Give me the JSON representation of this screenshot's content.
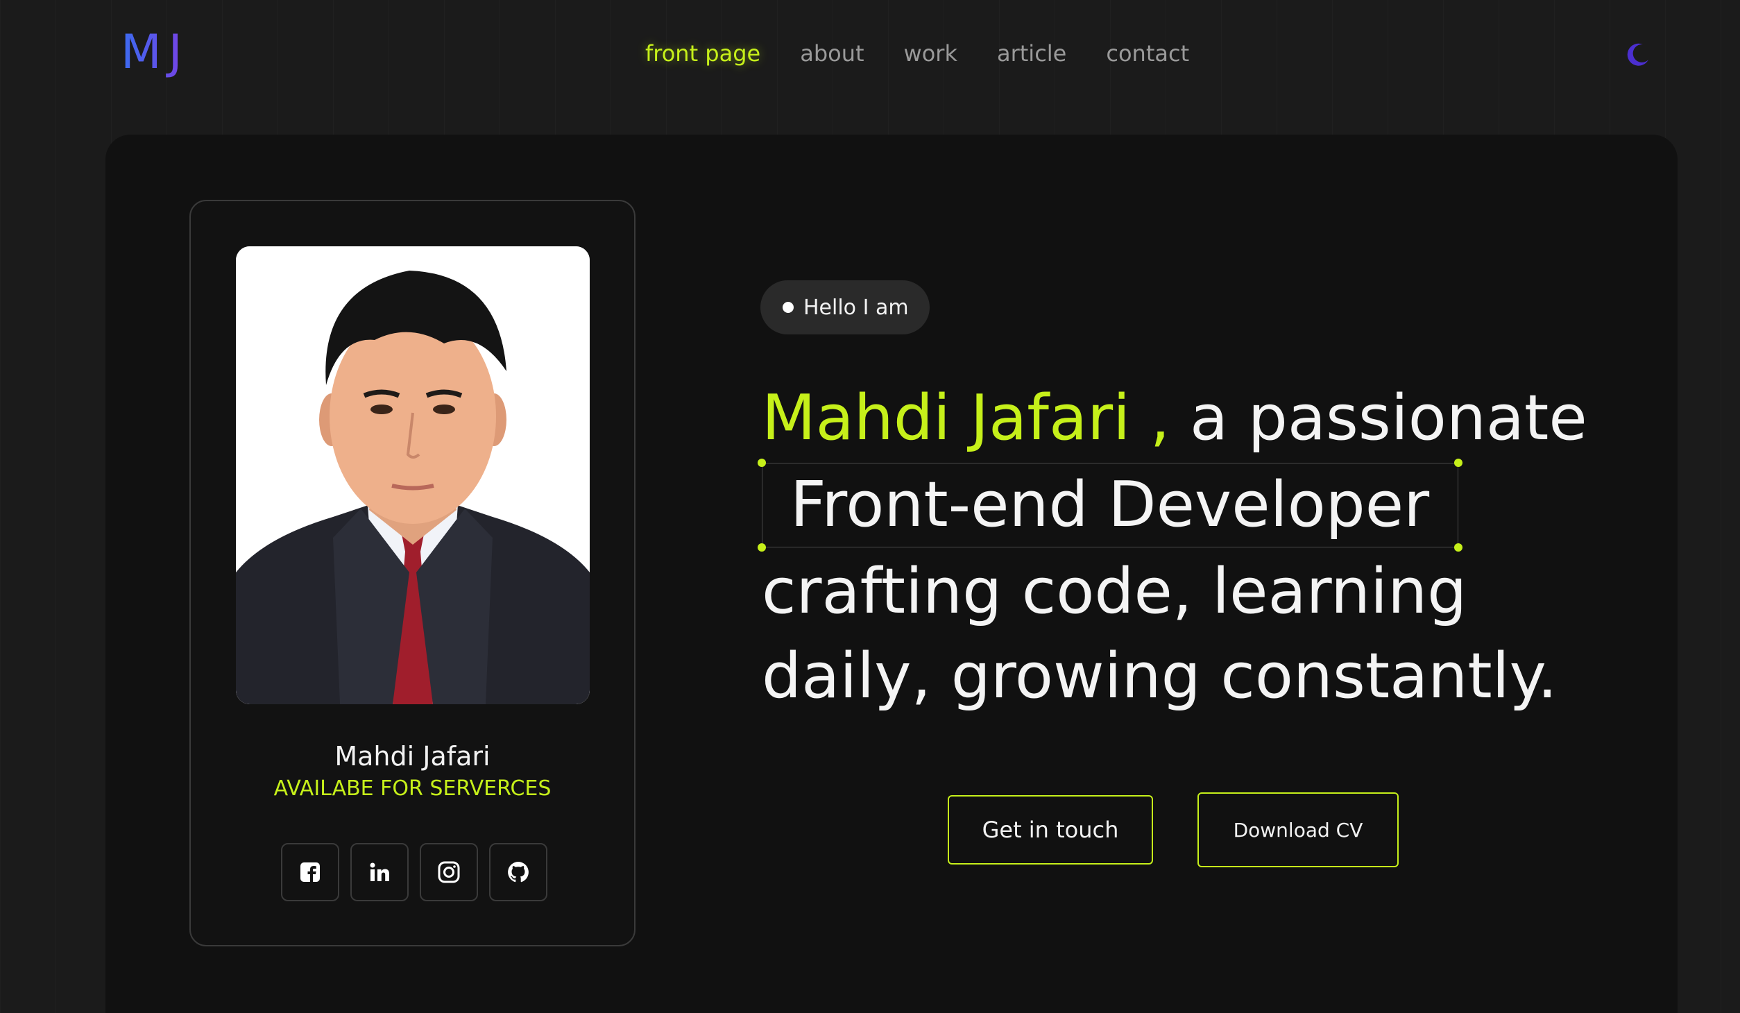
{
  "header": {
    "logo": "MJ",
    "nav": [
      {
        "label": "front page",
        "active": true
      },
      {
        "label": "about",
        "active": false
      },
      {
        "label": "work",
        "active": false
      },
      {
        "label": "article",
        "active": false
      },
      {
        "label": "contact",
        "active": false
      }
    ],
    "theme_icon": "moon-icon"
  },
  "profile": {
    "name": "Mahdi Jafari",
    "status": "AVAILABE FOR SERVERCES",
    "photo_icon": "profile-photo",
    "socials": [
      {
        "icon": "facebook-icon"
      },
      {
        "icon": "linkedin-icon"
      },
      {
        "icon": "instagram-icon"
      },
      {
        "icon": "github-icon"
      }
    ]
  },
  "hero": {
    "badge": "Hello I am",
    "name": "Mahdi Jafari ,",
    "line1_rest": " a passionate",
    "role": "Front-end Developer",
    "line3": "crafting code, learning",
    "line4": "daily, growing constantly."
  },
  "actions": {
    "get_in_touch": "Get in touch",
    "download_cv": "Download CV"
  },
  "colors": {
    "accent": "#c6f01a",
    "background": "#111111",
    "logo_gradient_start": "#3b6cf0",
    "logo_gradient_end": "#7b3fe4",
    "moon": "#4b2fd0"
  }
}
